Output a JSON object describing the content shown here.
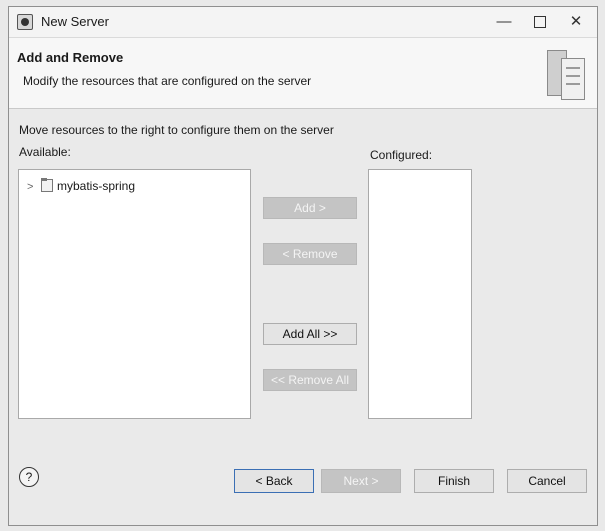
{
  "window": {
    "title": "New Server",
    "minimize": "—",
    "close": "✕"
  },
  "header": {
    "title": "Add and Remove",
    "description": "Modify the resources that are configured on the server"
  },
  "main": {
    "instructions": "Move resources to the right to configure them on the server",
    "available_label": "Available:",
    "configured_label": "Configured:",
    "available_items": [
      {
        "label": "mybatis-spring",
        "expanded": false
      }
    ],
    "configured_items": []
  },
  "buttons": {
    "add": "Add >",
    "remove": "< Remove",
    "add_all": "Add All >>",
    "remove_all": "<< Remove All"
  },
  "footer": {
    "help": "?",
    "back": "< Back",
    "next": "Next >",
    "finish": "Finish",
    "cancel": "Cancel"
  },
  "icons": {
    "app": "eclipse-icon",
    "server_graphic": "server-wizard-icon",
    "item": "project-icon",
    "help": "help-icon"
  }
}
